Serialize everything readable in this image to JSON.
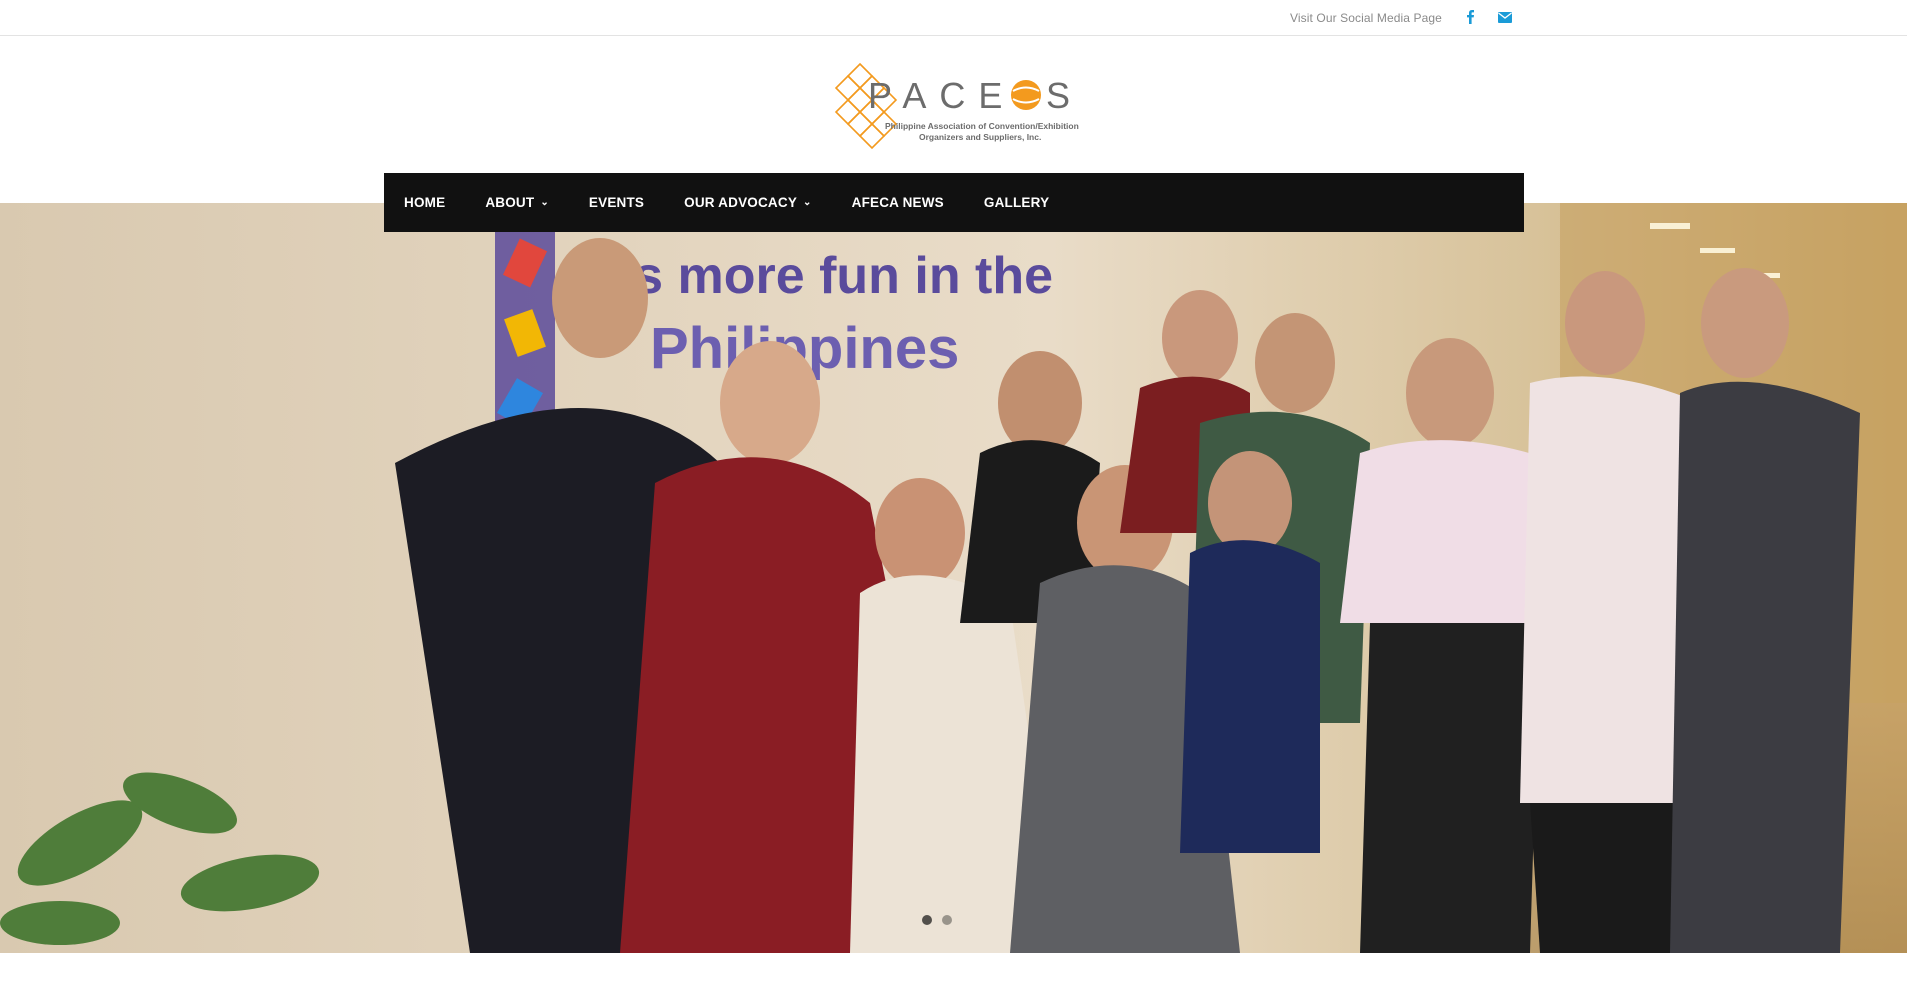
{
  "topbar": {
    "social_text": "Visit Our Social Media Page",
    "icons": [
      "facebook-icon",
      "envelope-icon"
    ],
    "icon_color": "#1a9bd7"
  },
  "logo": {
    "wordmark": "PACEOS",
    "tagline_line1": "Philippine Association of Convention/Exhibition",
    "tagline_line2": "Organizers and Suppliers, Inc.",
    "accent_color": "#f39a1e"
  },
  "nav": {
    "items": [
      {
        "label": "HOME",
        "has_dropdown": false
      },
      {
        "label": "ABOUT",
        "has_dropdown": true
      },
      {
        "label": "EVENTS",
        "has_dropdown": false
      },
      {
        "label": "OUR ADVOCACY",
        "has_dropdown": true
      },
      {
        "label": "AFECA NEWS",
        "has_dropdown": false
      },
      {
        "label": "GALLERY",
        "has_dropdown": false
      }
    ],
    "dropdown_glyph": "⌄",
    "background": "#111111"
  },
  "hero": {
    "banner_text_line1": "It's more fun in the",
    "banner_text_line2": "Philippines",
    "slides": 2,
    "active_slide": 1
  }
}
